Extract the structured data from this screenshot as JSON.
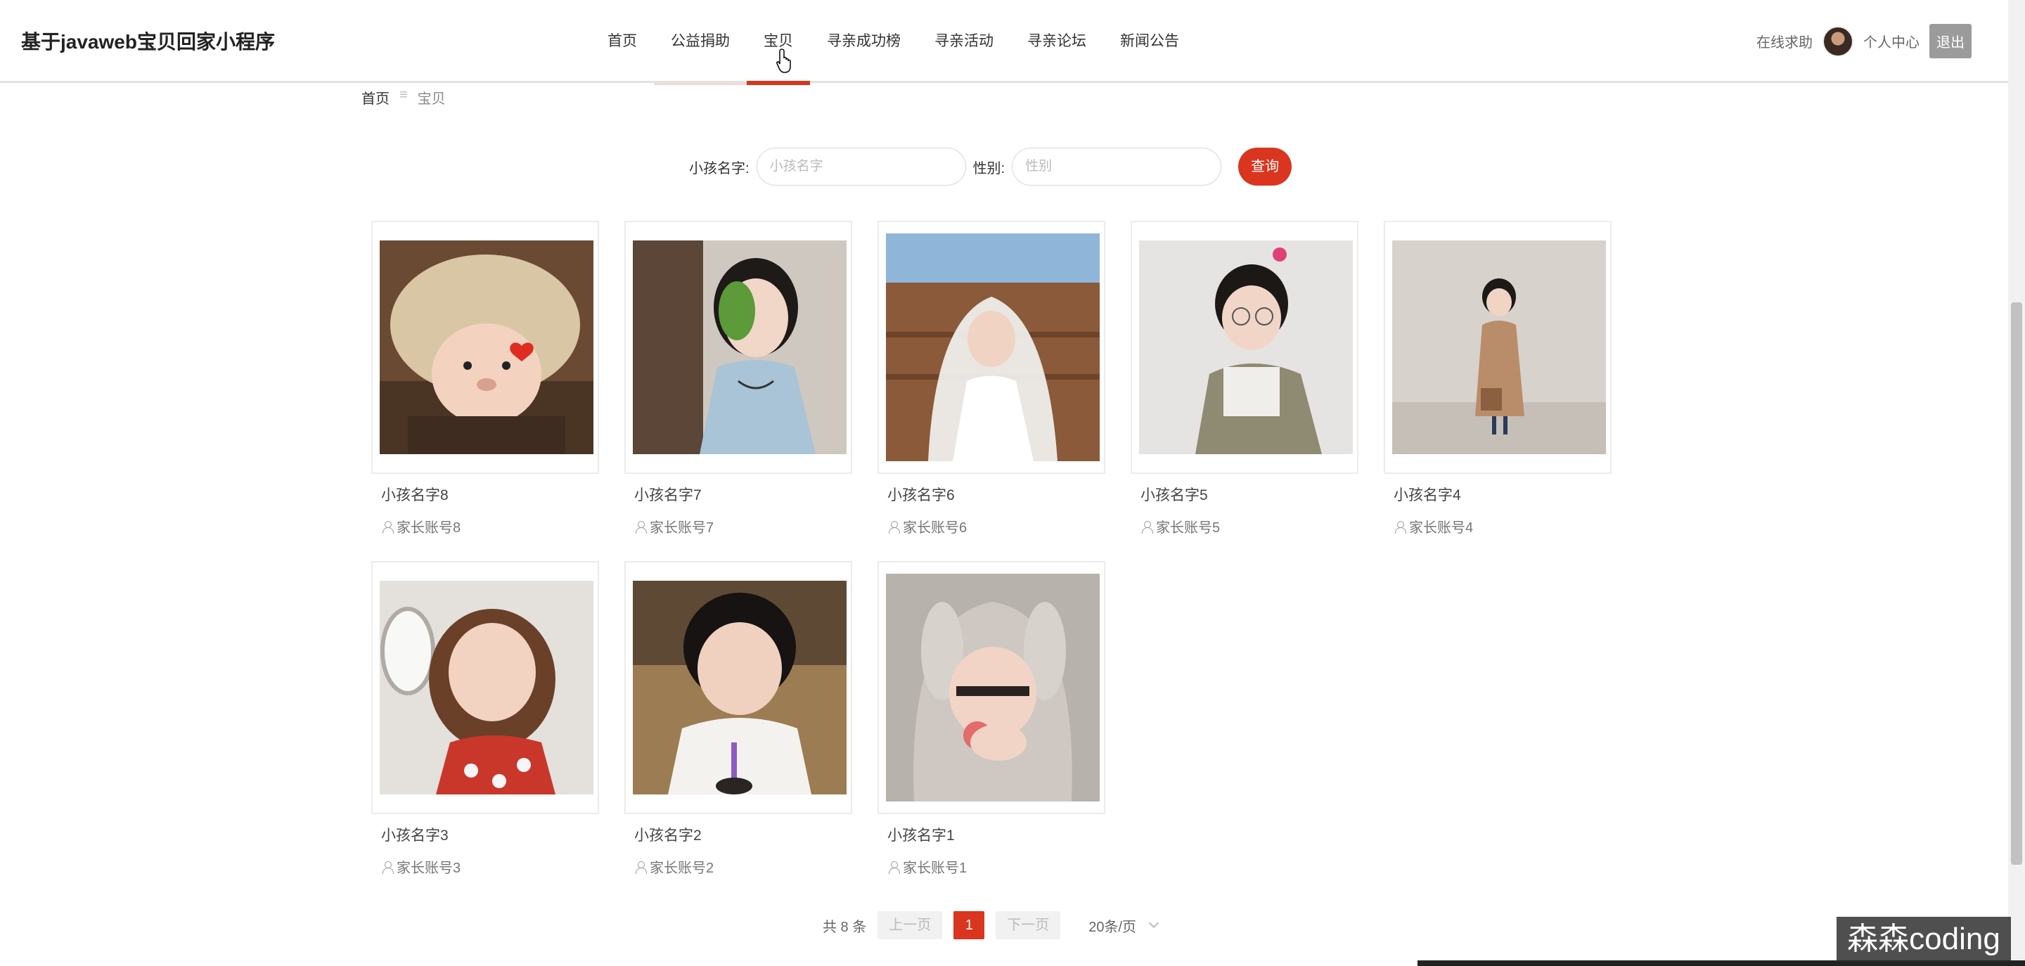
{
  "header": {
    "title": "基于javaweb宝贝回家小程序",
    "nav": [
      {
        "label": "首页",
        "state": ""
      },
      {
        "label": "公益捐助",
        "state": "hover"
      },
      {
        "label": "宝贝",
        "state": "active"
      },
      {
        "label": "寻亲成功榜",
        "state": ""
      },
      {
        "label": "寻亲活动",
        "state": ""
      },
      {
        "label": "寻亲论坛",
        "state": ""
      },
      {
        "label": "新闻公告",
        "state": ""
      }
    ],
    "help_label": "在线求助",
    "profile_label": "个人中心",
    "logout_label": "退出"
  },
  "breadcrumb": {
    "home": "首页",
    "sep": "≡",
    "current": "宝贝"
  },
  "search": {
    "name_label": "小孩名字:",
    "name_placeholder": "小孩名字",
    "gender_label": "性别:",
    "gender_placeholder": "性别",
    "query_label": "查询"
  },
  "items": [
    {
      "name": "小孩名字8",
      "parent": "家长账号8"
    },
    {
      "name": "小孩名字7",
      "parent": "家长账号7"
    },
    {
      "name": "小孩名字6",
      "parent": "家长账号6"
    },
    {
      "name": "小孩名字5",
      "parent": "家长账号5"
    },
    {
      "name": "小孩名字4",
      "parent": "家长账号4"
    },
    {
      "name": "小孩名字3",
      "parent": "家长账号3"
    },
    {
      "name": "小孩名字2",
      "parent": "家长账号2"
    },
    {
      "name": "小孩名字1",
      "parent": "家长账号1"
    }
  ],
  "pagination": {
    "total": "共 8 条",
    "prev": "上一页",
    "current": "1",
    "next": "下一页",
    "page_size": "20条/页"
  },
  "watermark": "森森coding",
  "colors": {
    "accent": "#d9351f"
  }
}
